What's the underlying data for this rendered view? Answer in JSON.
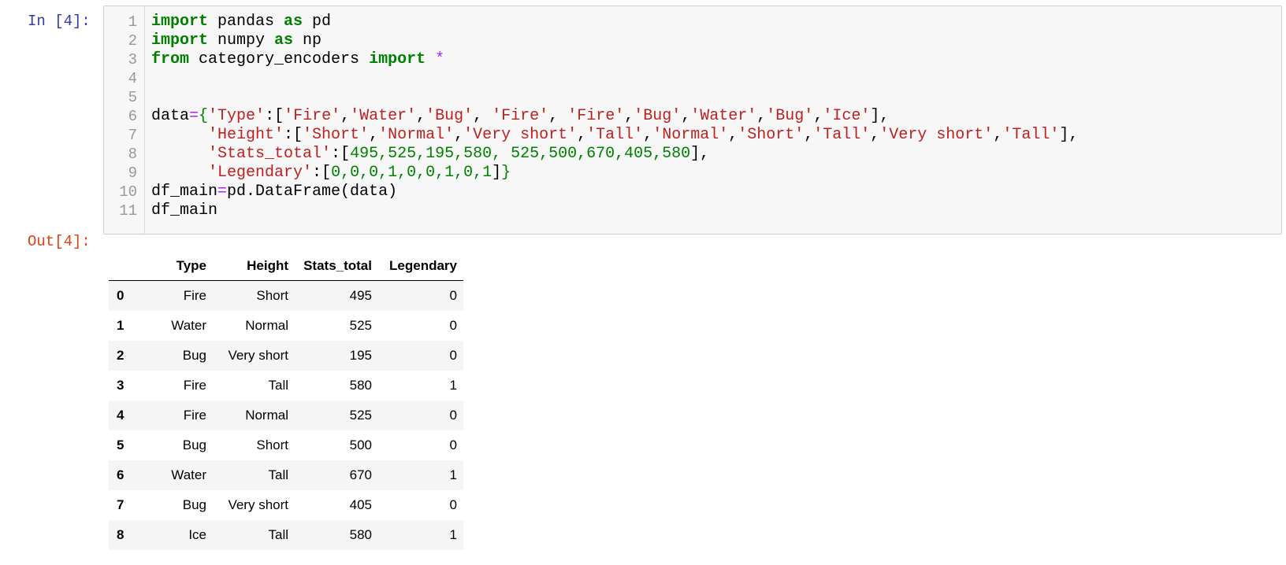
{
  "prompts": {
    "in": "In [4]:",
    "out": "Out[4]:"
  },
  "line_numbers": [
    "1",
    "2",
    "3",
    "4",
    "5",
    "6",
    "7",
    "8",
    "9",
    "10",
    "11"
  ],
  "code": {
    "l1": {
      "kw1": "import",
      "t1": " pandas ",
      "kw2": "as",
      "t2": " pd"
    },
    "l2": {
      "kw1": "import",
      "t1": " numpy ",
      "kw2": "as",
      "t2": " np"
    },
    "l3": {
      "kw1": "from",
      "t1": " category_encoders ",
      "kw2": "import",
      "op": "*"
    },
    "l6": {
      "t1": "data",
      "eq": "=",
      "b1": "{",
      "s1": "'Type'",
      "t2": ":[",
      "s2": "'Fire'",
      "c1": ",",
      "s3": "'Water'",
      "c2": ",",
      "s4": "'Bug'",
      "c3": ", ",
      "s5": "'Fire'",
      "c4": ", ",
      "s6": "'Fire'",
      "c5": ",",
      "s7": "'Bug'",
      "c6": ",",
      "s8": "'Water'",
      "c7": ",",
      "s9": "'Bug'",
      "c8": ",",
      "s10": "'Ice'",
      "t3": "],"
    },
    "l7": {
      "s1": "'Height'",
      "t1": ":[",
      "s2": "'Short'",
      "s3": "'Normal'",
      "s4": "'Very short'",
      "s5": "'Tall'",
      "s6": "'Normal'",
      "s7": "'Short'",
      "s8": "'Tall'",
      "s9": "'Very short'",
      "s10": "'Tall'",
      "sep": ",",
      "t2": "],"
    },
    "l8": {
      "s1": "'Stats_total'",
      "t1": ":[",
      "nums": "495,525,195,580, 525,500,670,405,580",
      "t2": "],"
    },
    "l9": {
      "s1": "'Legendary'",
      "t1": ":[",
      "nums": "0,0,0,1,0,0,1,0,1",
      "t2": "]",
      "b2": "}"
    },
    "l10": {
      "t1": "df_main",
      "eq": "=",
      "t2": "pd.DataFrame(data)"
    },
    "l11": {
      "t1": "df_main"
    }
  },
  "table": {
    "columns": [
      "",
      "Type",
      "Height",
      "Stats_total",
      "Legendary"
    ],
    "rows": [
      [
        "0",
        "Fire",
        "Short",
        "495",
        "0"
      ],
      [
        "1",
        "Water",
        "Normal",
        "525",
        "0"
      ],
      [
        "2",
        "Bug",
        "Very short",
        "195",
        "0"
      ],
      [
        "3",
        "Fire",
        "Tall",
        "580",
        "1"
      ],
      [
        "4",
        "Fire",
        "Normal",
        "525",
        "0"
      ],
      [
        "5",
        "Bug",
        "Short",
        "500",
        "0"
      ],
      [
        "6",
        "Water",
        "Tall",
        "670",
        "1"
      ],
      [
        "7",
        "Bug",
        "Very short",
        "405",
        "0"
      ],
      [
        "8",
        "Ice",
        "Tall",
        "580",
        "1"
      ]
    ]
  }
}
